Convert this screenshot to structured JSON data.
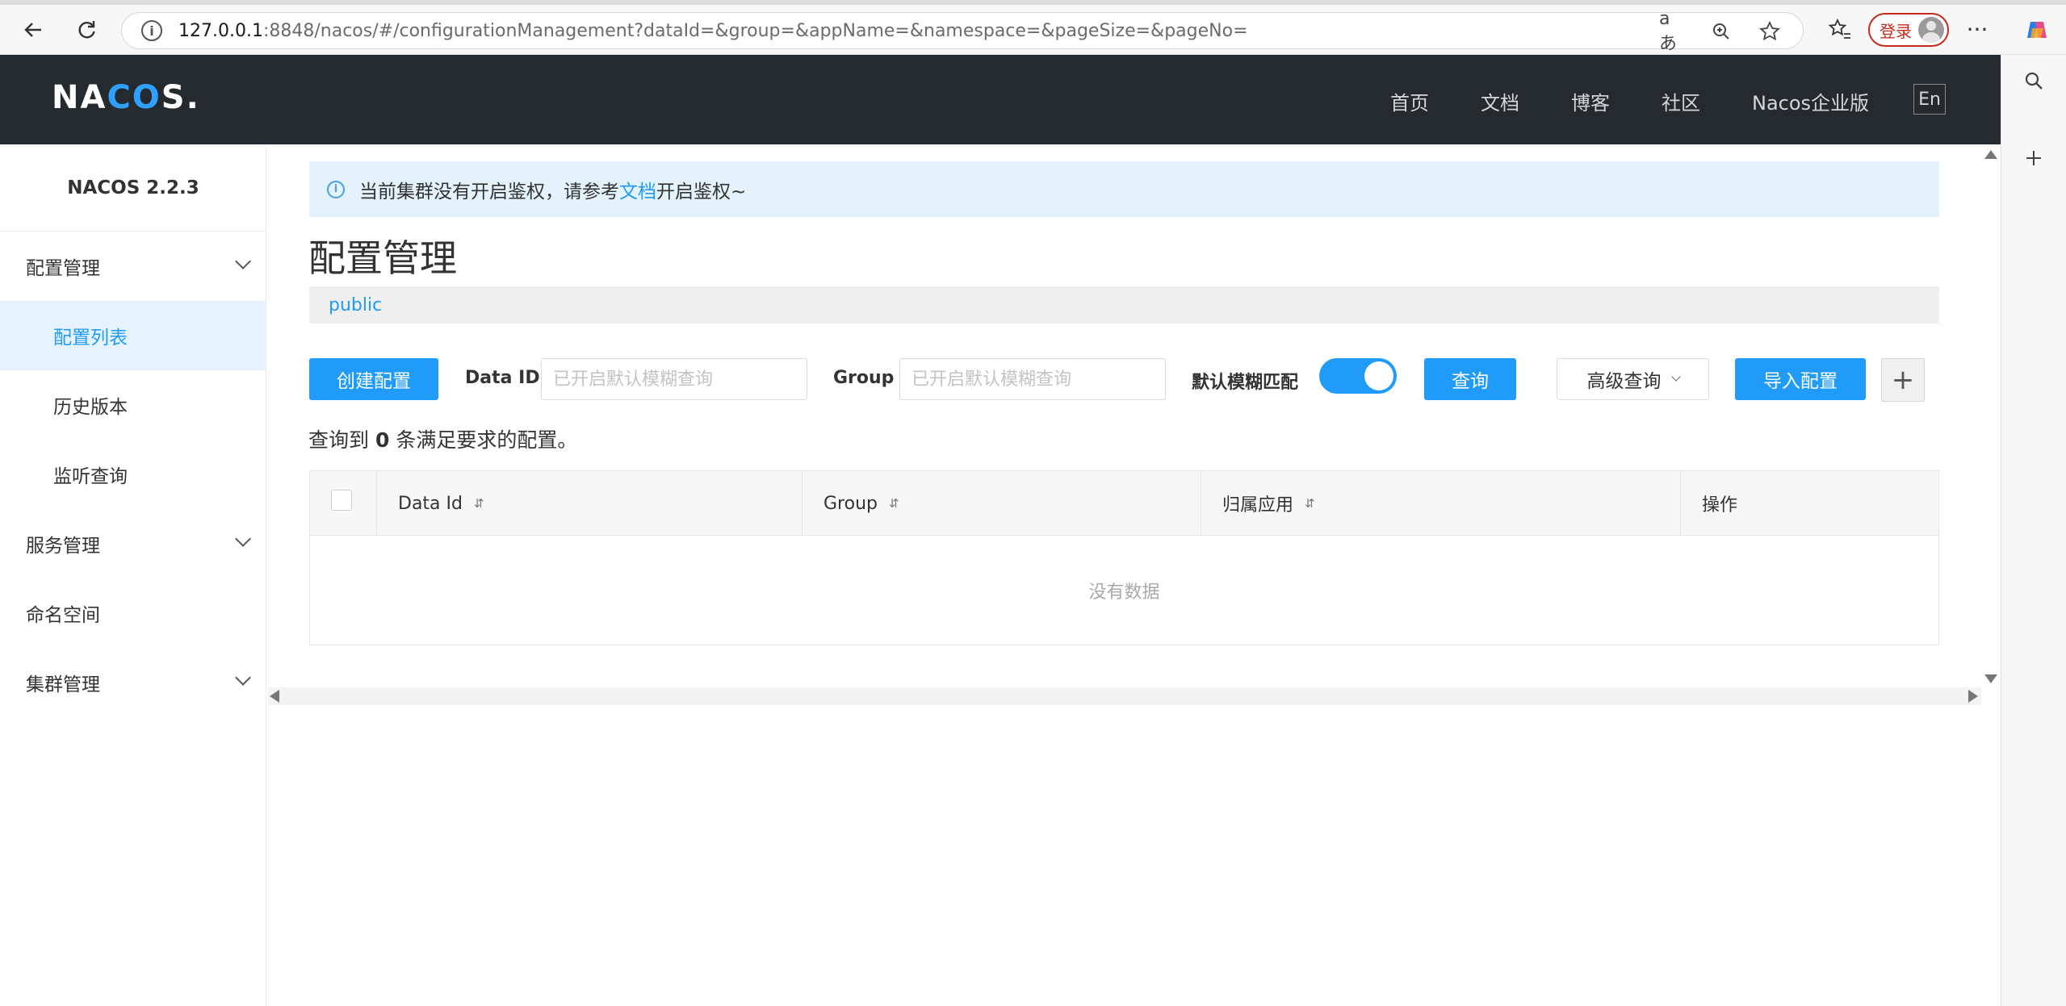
{
  "browser": {
    "url_host": "127.0.0.1",
    "url_rest": ":8848/nacos/#/configurationManagement?dataId=&group=&appName=&namespace=&pageSize=&pageNo=",
    "login_label": "登录",
    "icons": [
      "back-arrow-icon",
      "refresh-icon",
      "info-icon",
      "read-aloud-icon",
      "zoom-icon",
      "favorite-star-icon",
      "favorites-icon",
      "more-icon",
      "copilot-icon",
      "search-icon",
      "add-icon"
    ]
  },
  "header": {
    "logo_left": "NA",
    "logo_accent": "CO",
    "logo_right": "S.",
    "nav": [
      "首页",
      "文档",
      "博客",
      "社区",
      "Nacos企业版"
    ],
    "lang_label": "En"
  },
  "sidebar": {
    "version": "NACOS 2.2.3",
    "items": [
      {
        "label": "配置管理"
      },
      {
        "label": "配置列表"
      },
      {
        "label": "历史版本"
      },
      {
        "label": "监听查询"
      },
      {
        "label": "服务管理"
      },
      {
        "label": "命名空间"
      },
      {
        "label": "集群管理"
      }
    ]
  },
  "alert": {
    "text_before": "当前集群没有开启鉴权，请参考",
    "link": "文档",
    "text_after": "开启鉴权~"
  },
  "page": {
    "title": "配置管理",
    "namespace": "public"
  },
  "toolbar": {
    "create_label": "创建配置",
    "dataid_label": "Data ID",
    "dataid_placeholder": "已开启默认模糊查询",
    "group_label": "Group",
    "group_placeholder": "已开启默认模糊查询",
    "fuzzy_label": "默认模糊匹配",
    "fuzzy_enabled": true,
    "query_label": "查询",
    "advanced_label": "高级查询",
    "import_label": "导入配置",
    "plus_label": "+"
  },
  "result": {
    "prefix": "查询到",
    "count": "0",
    "suffix": "条满足要求的配置。"
  },
  "table": {
    "columns": [
      "Data Id",
      "Group",
      "归属应用",
      "操作"
    ],
    "sort_icon": "⇵",
    "empty_text": "没有数据"
  },
  "colors": {
    "primary": "#209bfa",
    "header_bg": "#252a2f",
    "alert_bg": "#e3f2fd",
    "active_bg": "#e6f3ff"
  }
}
